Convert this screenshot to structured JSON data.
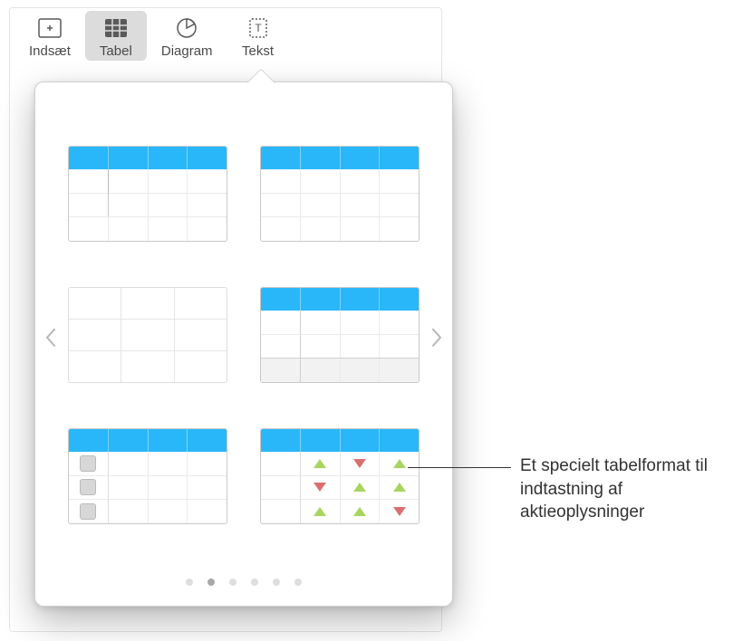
{
  "toolbar": {
    "insert_label": "Indsæt",
    "table_label": "Tabel",
    "chart_label": "Diagram",
    "text_label": "Tekst"
  },
  "popover": {
    "styles": [
      {
        "name": "blue-header-rowheader"
      },
      {
        "name": "blue-header-simple"
      },
      {
        "name": "no-header-plain"
      },
      {
        "name": "blue-header-footer"
      },
      {
        "name": "blue-header-checklist"
      },
      {
        "name": "blue-header-stock"
      }
    ],
    "page_count": 6,
    "active_page": 1
  },
  "callout": {
    "text": "Et specielt tabelformat til indtastning af aktieoplysninger"
  }
}
